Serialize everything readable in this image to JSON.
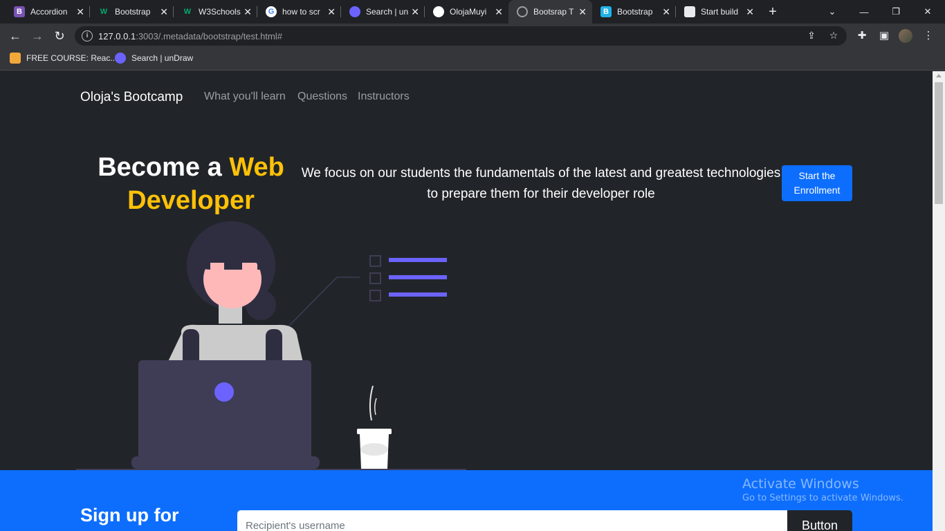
{
  "browser": {
    "tabs": [
      {
        "label": "Accordion",
        "icon": "bootstrap-icon"
      },
      {
        "label": "Bootstrap",
        "icon": "w3schools-icon"
      },
      {
        "label": "W3Schools",
        "icon": "w3schools-icon"
      },
      {
        "label": "how to scr",
        "icon": "google-icon"
      },
      {
        "label": "Search | un",
        "icon": "undraw-icon"
      },
      {
        "label": "OlojaMuyi",
        "icon": "github-icon"
      },
      {
        "label": "Bootsrap T",
        "icon": "globe-icon"
      },
      {
        "label": "Bootstrap",
        "icon": "bootstrap-blue-icon"
      },
      {
        "label": "Start build",
        "icon": "doc-icon"
      }
    ],
    "active_tab_index": 6,
    "url_host": "127.0.0.1",
    "url_rest": ":3003/.metadata/bootstrap/test.html#",
    "bookmarks": [
      {
        "label": "FREE COURSE: Reac..."
      },
      {
        "label": "Search | unDraw"
      }
    ]
  },
  "site": {
    "brand": "Oloja's Bootcamp",
    "nav": [
      "What you'll learn",
      "Questions",
      "Instructors"
    ],
    "hero": {
      "title_part1": "Become a ",
      "title_accent": "Web Developer",
      "text": "We focus on our students the fundamentals of the latest and greatest technologies to prepare them for their developer role",
      "cta": "Start the Enrollment"
    },
    "signup": {
      "title": "Sign up for",
      "placeholder": "Recipient's username",
      "button": "Button"
    }
  },
  "overlay": {
    "line1": "Activate Windows",
    "line2": "Go to Settings to activate Windows."
  },
  "colors": {
    "accent_yellow": "#ffc107",
    "primary_blue": "#0d6efd",
    "page_bg": "#212529",
    "illustration_purple": "#6c63ff"
  }
}
